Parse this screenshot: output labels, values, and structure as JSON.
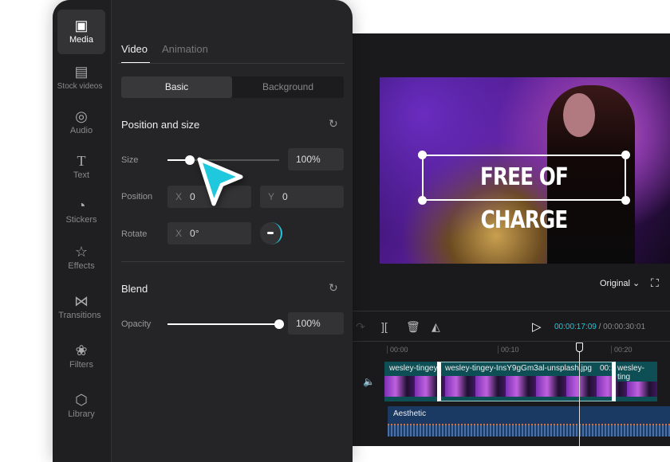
{
  "sidebar": {
    "items": [
      {
        "label": "Media",
        "icon": "media-icon"
      },
      {
        "label": "Stock videos",
        "icon": "layout-icon"
      },
      {
        "label": "Audio",
        "icon": "music-icon"
      },
      {
        "label": "Text",
        "icon": "text-icon"
      },
      {
        "label": "Stickers",
        "icon": "sticker-icon"
      },
      {
        "label": "Effects",
        "icon": "star-icon"
      },
      {
        "label": "Transitions",
        "icon": "transition-icon"
      },
      {
        "label": "Filters",
        "icon": "filters-icon"
      },
      {
        "label": "Library",
        "icon": "cube-icon"
      }
    ]
  },
  "tabs": {
    "video": "Video",
    "animation": "Animation"
  },
  "subtabs": {
    "basic": "Basic",
    "background": "Background"
  },
  "position_size": {
    "title": "Position and size",
    "size_label": "Size",
    "size_value": "100%",
    "size_slider": 0.2,
    "position_label": "Position",
    "x_label": "X",
    "x_value": "0",
    "y_label": "Y",
    "y_value": "0",
    "rotate_label": "Rotate",
    "rotate_x_label": "X",
    "rotate_value": "0°"
  },
  "blend": {
    "title": "Blend",
    "opacity_label": "Opacity",
    "opacity_value": "100%",
    "opacity_slider": 1.0
  },
  "preview": {
    "overlay_text": "FREE OF CHARGE",
    "ratio": "Original"
  },
  "timeline": {
    "current": "00:00:17:09",
    "separator": "/",
    "total": "00:00:30:01",
    "ticks": [
      "00:00",
      "00:10",
      "00:20"
    ],
    "clips": [
      "wesley-tingey",
      "wesley-tingey-InsY9gGm3al-unsplash.jpg",
      "00:1",
      "wesley-ting"
    ],
    "audio": "Aesthetic"
  },
  "colors": {
    "accent": "#1fc8dc",
    "clip": "#0e4f55",
    "audio": "#1b3a63"
  }
}
